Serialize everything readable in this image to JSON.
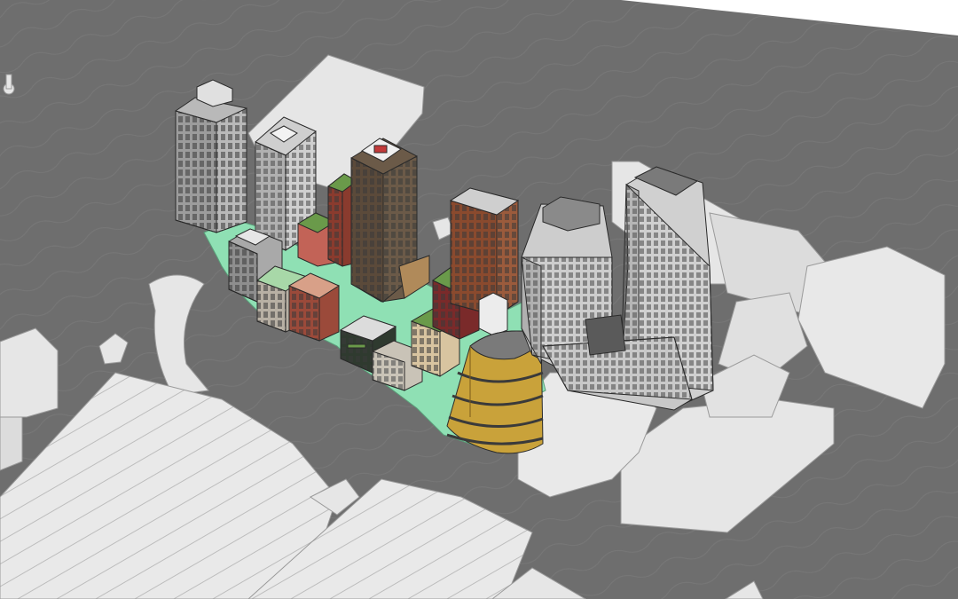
{
  "image": {
    "kind": "architectural-massing-render",
    "view": "axonometric",
    "ground_color": "#6e6e6e",
    "context_massing_color": "#e4e4e4",
    "landscape_color": "#8fe0b4",
    "proposed_building_colors": {
      "brick_red": "#8a3b2e",
      "brick_brown": "#9b5b3c",
      "dark_brown": "#5b4a3a",
      "stone_light": "#c9c3b7",
      "grey_facade": "#a9a9a9",
      "gold_terrace": "#c9a23a",
      "green_roof": "#6a9a4a",
      "sand": "#d8c4a0"
    }
  }
}
